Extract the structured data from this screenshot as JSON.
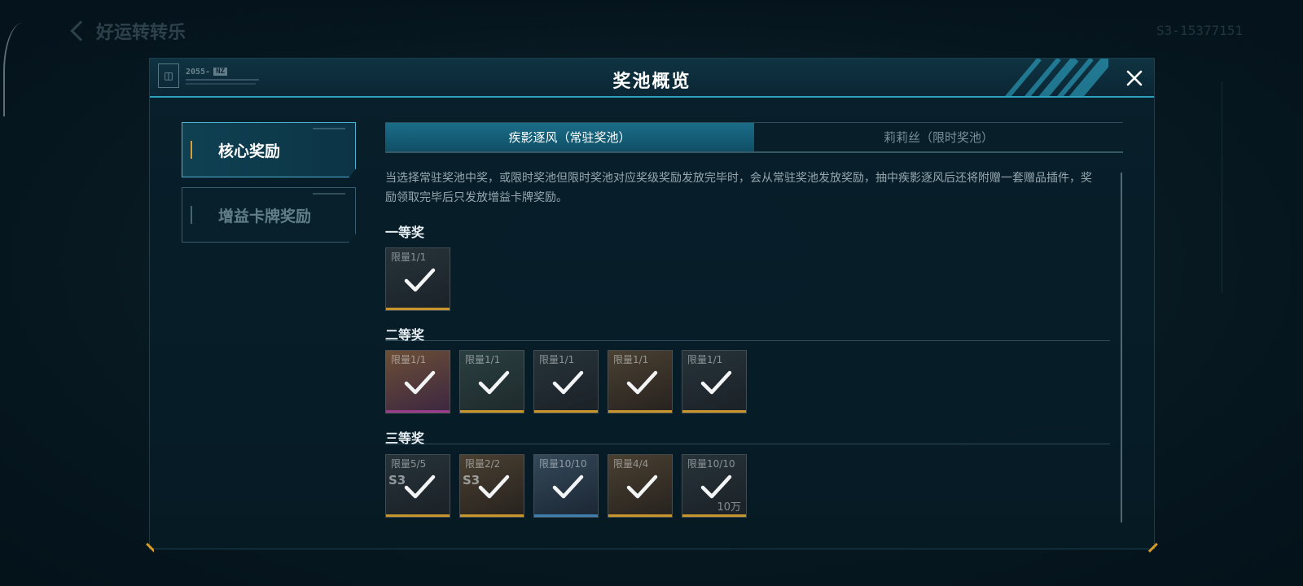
{
  "background": {
    "back_label": "好运转转乐",
    "code": "S3-15377151"
  },
  "modal": {
    "title": "奖池概览",
    "brand": {
      "code": "2055-",
      "tag": "NZ"
    },
    "close_icon": "close-icon"
  },
  "menu": {
    "items": [
      {
        "label": "核心奖励",
        "active": true
      },
      {
        "label": "增益卡牌奖励",
        "active": false
      }
    ]
  },
  "tabs": [
    {
      "label": "疾影逐风（常驻奖池）",
      "active": true
    },
    {
      "label": "莉莉丝（限时奖池）",
      "active": false
    }
  ],
  "description": "当选择常驻奖池中奖，或限时奖池但限时奖池对应奖级奖励发放完毕时，会从常驻奖池发放奖励，抽中疾影逐风后还将附赠一套赠品插件，奖励领取完毕后只发放增益卡牌奖励。",
  "sections": [
    {
      "title": "一等奖",
      "items": [
        {
          "limit": "限量1/1",
          "style": "dark",
          "claimed": true
        }
      ]
    },
    {
      "title": "二等奖",
      "items": [
        {
          "limit": "限量1/1",
          "style": "purple",
          "claimed": true
        },
        {
          "limit": "限量1/1",
          "style": "greenish",
          "claimed": true
        },
        {
          "limit": "限量1/1",
          "style": "dark",
          "claimed": true
        },
        {
          "limit": "限量1/1",
          "style": "amber",
          "claimed": true
        },
        {
          "limit": "限量1/1",
          "style": "dark",
          "claimed": true
        }
      ]
    },
    {
      "title": "三等奖",
      "items": [
        {
          "limit": "限量5/5",
          "prefix": "S3",
          "style": "dark",
          "claimed": true
        },
        {
          "limit": "限量2/2",
          "prefix": "S3",
          "style": "amber",
          "claimed": true
        },
        {
          "limit": "限量10/10",
          "style": "blue",
          "claimed": true
        },
        {
          "limit": "限量4/4",
          "style": "amber",
          "claimed": true
        },
        {
          "limit": "限量10/10",
          "amount": "10万",
          "style": "dark",
          "claimed": true
        }
      ]
    }
  ],
  "colors": {
    "accent": "#2d9fbf",
    "active_bar": "#d6a03a",
    "rarity_gold": "#c9962e",
    "rarity_purple": "#9a3c8e",
    "rarity_blue": "#3f7fb0"
  }
}
